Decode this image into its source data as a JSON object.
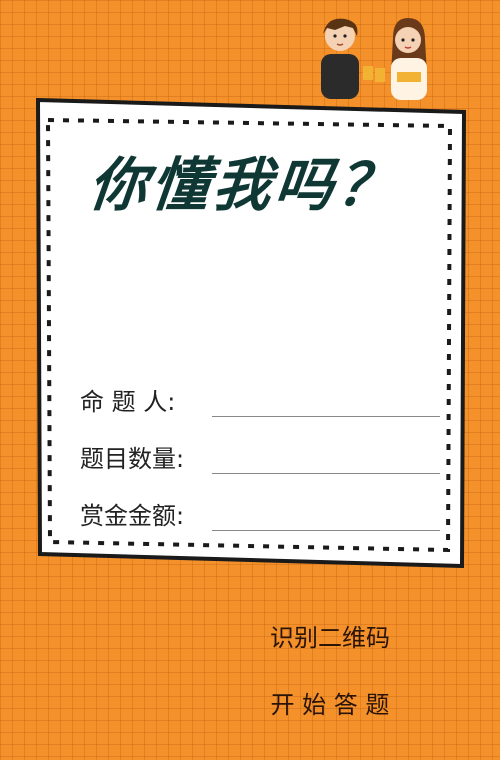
{
  "title": "你懂我吗？",
  "fields": [
    {
      "label": "命 题 人:"
    },
    {
      "label": "题目数量:"
    },
    {
      "label": "赏金金额:"
    }
  ],
  "cta": {
    "scan_text": "识别二维码",
    "start_text": "开 始 答 题"
  },
  "colors": {
    "background": "#f5912a",
    "title": "#0f3834",
    "frame": "#1a1a1a"
  },
  "icons": [
    "couple-illustration"
  ]
}
